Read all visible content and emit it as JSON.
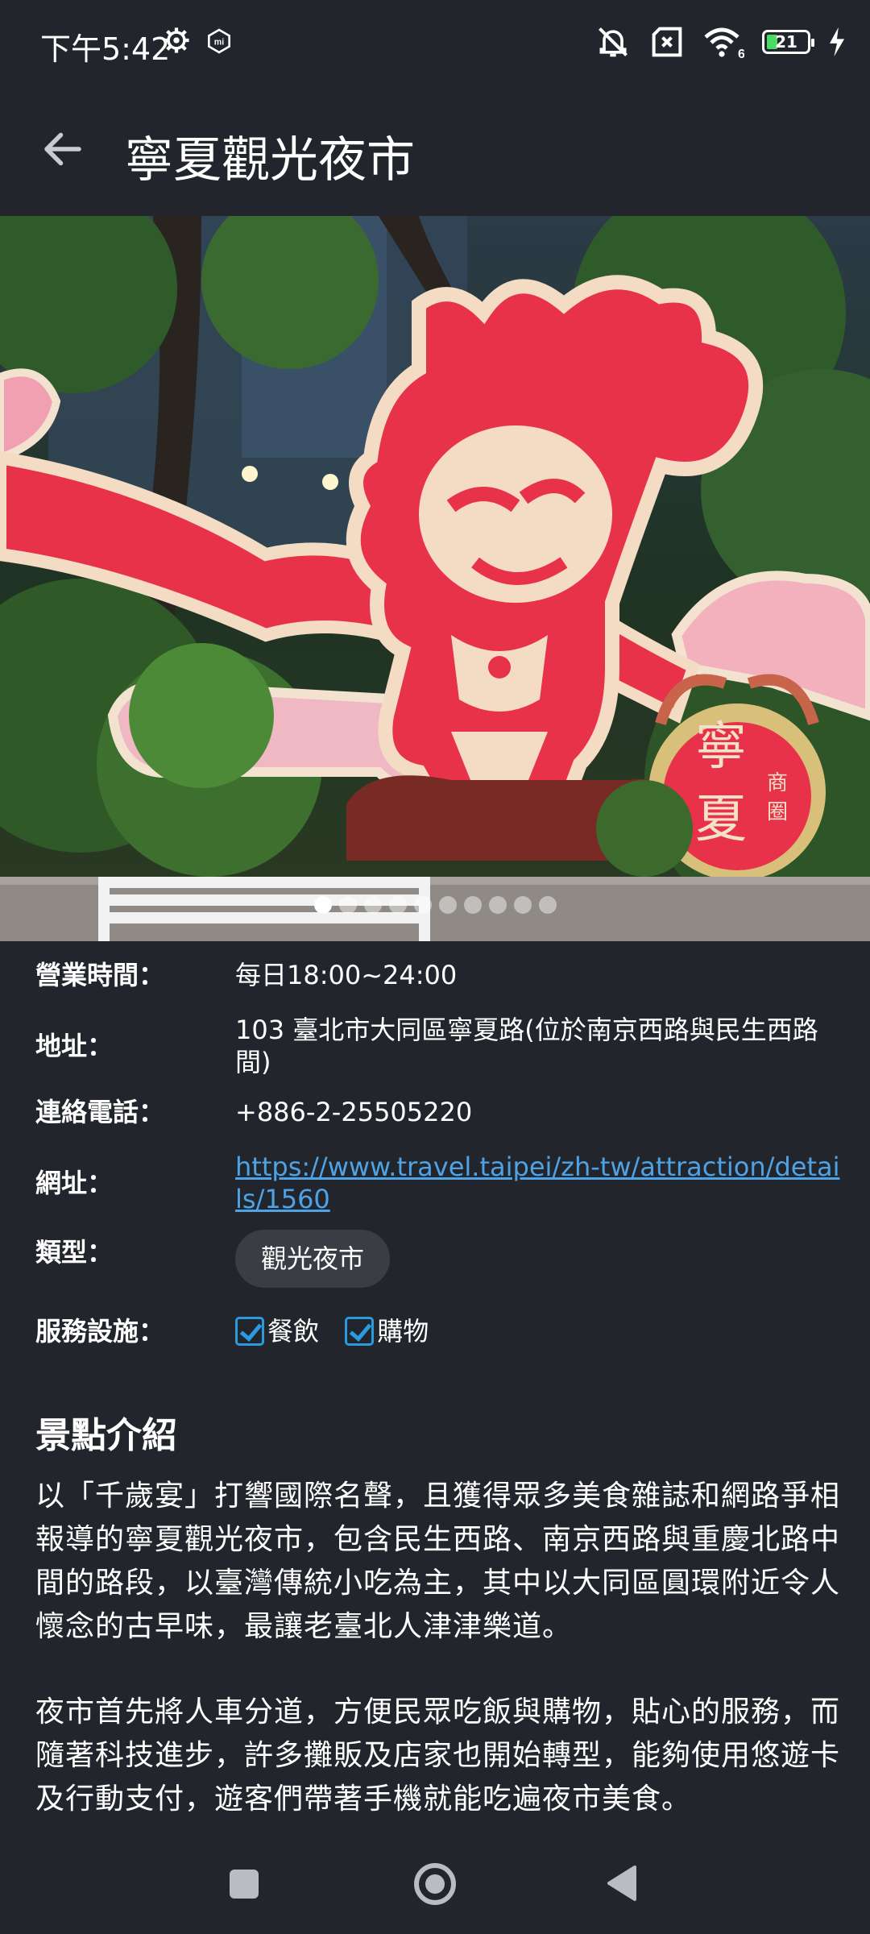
{
  "status_bar": {
    "time": "下午5:42",
    "battery": "21",
    "icons": [
      "gear-icon",
      "mi-icon",
      "mute-icon",
      "sim-x-icon",
      "wifi-6-icon",
      "battery-icon",
      "charging-icon"
    ]
  },
  "header": {
    "title": "寧夏觀光夜市",
    "back_icon": "arrow-left-icon"
  },
  "carousel": {
    "total": 10,
    "active": 1
  },
  "info": {
    "hours_label": "營業時間：",
    "hours_value": "每日18:00~24:00",
    "address_label": "地址：",
    "address_value": "103 臺北市大同區寧夏路(位於南京西路與民生西路間)",
    "phone_label": "連絡電話：",
    "phone_value": "+886-2-25505220",
    "url_label": "網址：",
    "url_value": "https://www.travel.taipei/zh-tw/attraction/details/1560",
    "type_label": "類型：",
    "type_value": "觀光夜市",
    "services_label": "服務設施：",
    "services": [
      "餐飲",
      "購物"
    ]
  },
  "intro": {
    "title": "景點介紹",
    "paragraph1": "以「千歲宴」打響國際名聲，且獲得眾多美食雜誌和網路爭相報導的寧夏觀光夜市，包含民生西路、南京西路與重慶北路中間的路段，以臺灣傳統小吃為主，其中以大同區圓環附近令人懷念的古早味，最讓老臺北人津津樂道。",
    "paragraph2": "夜市首先將人車分道，方便民眾吃飯與購物，貼心的服務，而隨著科技進步，許多攤販及店家也開始轉型，能夠使用悠遊卡及行動支付，遊客們帶著手機就能吃遍夜市美食。"
  },
  "hero_sign": {
    "char1": "寧",
    "char2": "夏",
    "small1": "商",
    "small2": "圈"
  },
  "colors": {
    "background": "#22252b",
    "link": "#4ea3e6",
    "checkbox": "#2a9bdf",
    "chip": "#3a3d44"
  }
}
